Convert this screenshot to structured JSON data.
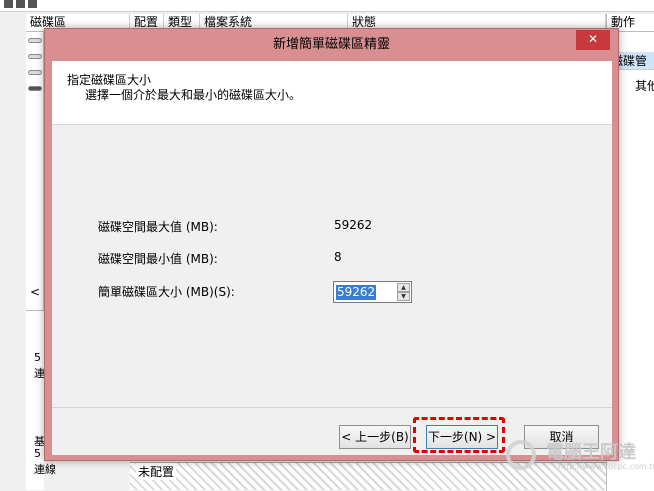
{
  "background": {
    "columns": [
      "磁碟區",
      "配置",
      "類型",
      "檔案系統",
      "狀態"
    ],
    "actions_header": "動作",
    "actions_selected": "磁碟管",
    "actions_sub": "其他",
    "left_items": [
      "5",
      "連",
      "基",
      "5",
      "連線"
    ],
    "unallocated": "未配置"
  },
  "dialog": {
    "title": "新增簡單磁碟區精靈",
    "close_label": "✕",
    "header_title": "指定磁碟區大小",
    "header_subtitle": "選擇一個介於最大和最小的磁碟區大小。",
    "rows": [
      {
        "label": "磁碟空間最大值 (MB):",
        "value": "59262"
      },
      {
        "label": "磁碟空間最小值 (MB):",
        "value": "8"
      }
    ],
    "size_label": "簡單磁碟區大小 (MB)(S):",
    "size_value": "59262",
    "buttons": {
      "back": "< 上一步(B)",
      "next": "下一步(N) >",
      "cancel": "取消"
    }
  },
  "watermark": {
    "text": "電腦王阿達",
    "url": "http://www.kocpc.com.tw"
  }
}
